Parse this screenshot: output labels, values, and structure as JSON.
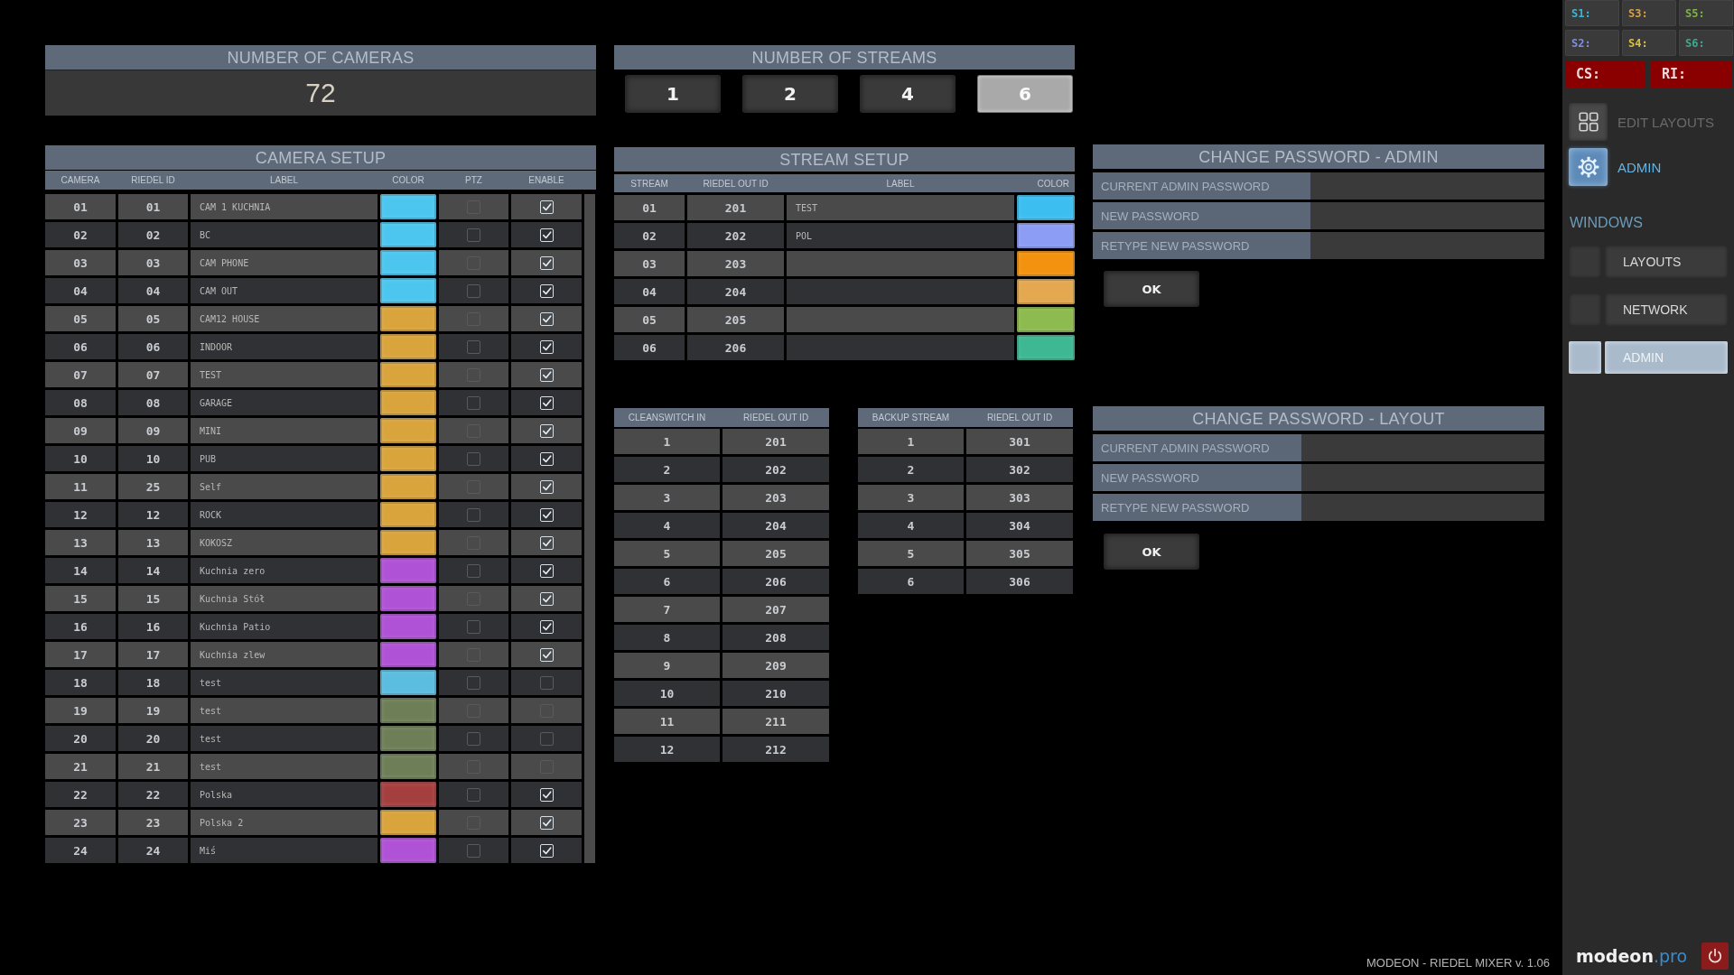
{
  "number_of_cameras": {
    "title": "NUMBER OF CAMERAS",
    "value": "72"
  },
  "number_of_streams": {
    "title": "NUMBER OF STREAMS",
    "options": [
      {
        "label": "1",
        "selected": false
      },
      {
        "label": "2",
        "selected": false
      },
      {
        "label": "4",
        "selected": false
      },
      {
        "label": "6",
        "selected": true
      }
    ]
  },
  "camera_setup": {
    "title": "CAMERA SETUP",
    "columns": [
      "CAMERA",
      "RIEDEL ID",
      "LABEL",
      "COLOR",
      "PTZ",
      "ENABLE"
    ],
    "rows": [
      {
        "camera": "01",
        "riedel_id": "01",
        "label": "CAM 1 KUCHNIA",
        "color": "#4cc6ef",
        "ptz": false,
        "enable": true
      },
      {
        "camera": "02",
        "riedel_id": "02",
        "label": "BC",
        "color": "#4cc6ef",
        "ptz": false,
        "enable": true
      },
      {
        "camera": "03",
        "riedel_id": "03",
        "label": "CAM PHONE",
        "color": "#4cc6ef",
        "ptz": false,
        "enable": true
      },
      {
        "camera": "04",
        "riedel_id": "04",
        "label": "CAM OUT",
        "color": "#4cc6ef",
        "ptz": false,
        "enable": true
      },
      {
        "camera": "05",
        "riedel_id": "05",
        "label": "CAM12 HOUSE",
        "color": "#d9a43c",
        "ptz": false,
        "enable": true
      },
      {
        "camera": "06",
        "riedel_id": "06",
        "label": "INDOOR",
        "color": "#d9a43c",
        "ptz": false,
        "enable": true
      },
      {
        "camera": "07",
        "riedel_id": "07",
        "label": "TEST",
        "color": "#d9a43c",
        "ptz": false,
        "enable": true
      },
      {
        "camera": "08",
        "riedel_id": "08",
        "label": "GARAGE",
        "color": "#d9a43c",
        "ptz": false,
        "enable": true
      },
      {
        "camera": "09",
        "riedel_id": "09",
        "label": "MINI",
        "color": "#d9a43c",
        "ptz": false,
        "enable": true
      },
      {
        "camera": "10",
        "riedel_id": "10",
        "label": "PUB",
        "color": "#d9a43c",
        "ptz": false,
        "enable": true
      },
      {
        "camera": "11",
        "riedel_id": "25",
        "label": "Self",
        "color": "#d9a43c",
        "ptz": false,
        "enable": true
      },
      {
        "camera": "12",
        "riedel_id": "12",
        "label": "ROCK",
        "color": "#d9a43c",
        "ptz": false,
        "enable": true
      },
      {
        "camera": "13",
        "riedel_id": "13",
        "label": "KOKOSZ",
        "color": "#d9a43c",
        "ptz": false,
        "enable": true
      },
      {
        "camera": "14",
        "riedel_id": "14",
        "label": "Kuchnia zero",
        "color": "#b052d6",
        "ptz": false,
        "enable": true
      },
      {
        "camera": "15",
        "riedel_id": "15",
        "label": "Kuchnia Stół",
        "color": "#b052d6",
        "ptz": false,
        "enable": true
      },
      {
        "camera": "16",
        "riedel_id": "16",
        "label": "Kuchnia Patio",
        "color": "#b052d6",
        "ptz": false,
        "enable": true
      },
      {
        "camera": "17",
        "riedel_id": "17",
        "label": "Kuchnia zlew",
        "color": "#b052d6",
        "ptz": false,
        "enable": true
      },
      {
        "camera": "18",
        "riedel_id": "18",
        "label": "test",
        "color": "#5bbde0",
        "ptz": false,
        "enable": false
      },
      {
        "camera": "19",
        "riedel_id": "19",
        "label": "test",
        "color": "#6e7f58",
        "ptz": false,
        "enable": false
      },
      {
        "camera": "20",
        "riedel_id": "20",
        "label": "test",
        "color": "#6e7f58",
        "ptz": false,
        "enable": false
      },
      {
        "camera": "21",
        "riedel_id": "21",
        "label": "test",
        "color": "#6e7f58",
        "ptz": false,
        "enable": false
      },
      {
        "camera": "22",
        "riedel_id": "22",
        "label": "Polska",
        "color": "#a53f3f",
        "ptz": false,
        "enable": true
      },
      {
        "camera": "23",
        "riedel_id": "23",
        "label": "Polska 2",
        "color": "#d9a43c",
        "ptz": false,
        "enable": true
      },
      {
        "camera": "24",
        "riedel_id": "24",
        "label": "Miś",
        "color": "#b052d6",
        "ptz": false,
        "enable": true
      }
    ]
  },
  "stream_setup": {
    "title": "STREAM SETUP",
    "columns": [
      "STREAM",
      "RIEDEL OUT ID",
      "LABEL",
      "COLOR"
    ],
    "rows": [
      {
        "stream": "01",
        "riedel_out_id": "201",
        "label": "TEST",
        "color": "#3cbff0"
      },
      {
        "stream": "02",
        "riedel_out_id": "202",
        "label": "POL",
        "color": "#8c9df5"
      },
      {
        "stream": "03",
        "riedel_out_id": "203",
        "color": "#f3920f"
      },
      {
        "stream": "04",
        "riedel_out_id": "204",
        "color": "#e3a850"
      },
      {
        "stream": "05",
        "riedel_out_id": "205",
        "color": "#8dbb4f"
      },
      {
        "stream": "06",
        "riedel_out_id": "206",
        "color": "#3db893"
      }
    ]
  },
  "cleanswitch_table": {
    "columns": [
      "CLEANSWITCH IN",
      "RIEDEL OUT ID"
    ],
    "rows": [
      {
        "cleanswitch_in": "1",
        "riedel_out_id": "201"
      },
      {
        "cleanswitch_in": "2",
        "riedel_out_id": "202"
      },
      {
        "cleanswitch_in": "3",
        "riedel_out_id": "203"
      },
      {
        "cleanswitch_in": "4",
        "riedel_out_id": "204"
      },
      {
        "cleanswitch_in": "5",
        "riedel_out_id": "205"
      },
      {
        "cleanswitch_in": "6",
        "riedel_out_id": "206"
      },
      {
        "cleanswitch_in": "7",
        "riedel_out_id": "207"
      },
      {
        "cleanswitch_in": "8",
        "riedel_out_id": "208"
      },
      {
        "cleanswitch_in": "9",
        "riedel_out_id": "209"
      },
      {
        "cleanswitch_in": "10",
        "riedel_out_id": "210"
      },
      {
        "cleanswitch_in": "11",
        "riedel_out_id": "211"
      },
      {
        "cleanswitch_in": "12",
        "riedel_out_id": "212"
      }
    ]
  },
  "backup_table": {
    "columns": [
      "BACKUP STREAM",
      "RIEDEL OUT ID"
    ],
    "rows": [
      {
        "backup_stream": "1",
        "riedel_out_id": "301"
      },
      {
        "backup_stream": "2",
        "riedel_out_id": "302"
      },
      {
        "backup_stream": "3",
        "riedel_out_id": "303"
      },
      {
        "backup_stream": "4",
        "riedel_out_id": "304"
      },
      {
        "backup_stream": "5",
        "riedel_out_id": "305"
      },
      {
        "backup_stream": "6",
        "riedel_out_id": "306"
      }
    ]
  },
  "change_password_admin": {
    "title": "CHANGE PASSWORD - ADMIN",
    "fields": [
      {
        "label": "CURRENT ADMIN PASSWORD"
      },
      {
        "label": "NEW PASSWORD"
      },
      {
        "label": "RETYPE NEW PASSWORD"
      }
    ],
    "button": "OK"
  },
  "change_password_layout": {
    "title": "CHANGE PASSWORD - LAYOUT",
    "fields": [
      {
        "label": "CURRENT ADMIN PASSWORD"
      },
      {
        "label": "NEW PASSWORD"
      },
      {
        "label": "RETYPE NEW PASSWORD"
      }
    ],
    "button": "OK"
  },
  "sidebar": {
    "stream_indicators": [
      {
        "label": "S1:",
        "color": "#38b8d8"
      },
      {
        "label": "S3:",
        "color": "#d8a040"
      },
      {
        "label": "S5:",
        "color": "#80b048"
      },
      {
        "label": "S2:",
        "color": "#7f8fe0"
      },
      {
        "label": "S4:",
        "color": "#d8c040"
      },
      {
        "label": "S6:",
        "color": "#40a890"
      }
    ],
    "status_indicators": [
      {
        "label": "CS:"
      },
      {
        "label": "RI:"
      }
    ],
    "nav": [
      {
        "label": "EDIT LAYOUTS",
        "kind": "layouts",
        "selected": false
      },
      {
        "label": "ADMIN",
        "kind": "settings",
        "selected": true
      }
    ],
    "windows_heading": "WINDOWS",
    "windows": [
      {
        "label": "LAYOUTS",
        "selected": false
      },
      {
        "label": "NETWORK",
        "selected": false
      },
      {
        "label": "ADMIN",
        "selected": true
      }
    ],
    "logo": {
      "name": "modeon",
      "suffix": ".pro"
    }
  },
  "status_bar": {
    "version": "MODEON - RIEDEL MIXER v. 1.06"
  }
}
